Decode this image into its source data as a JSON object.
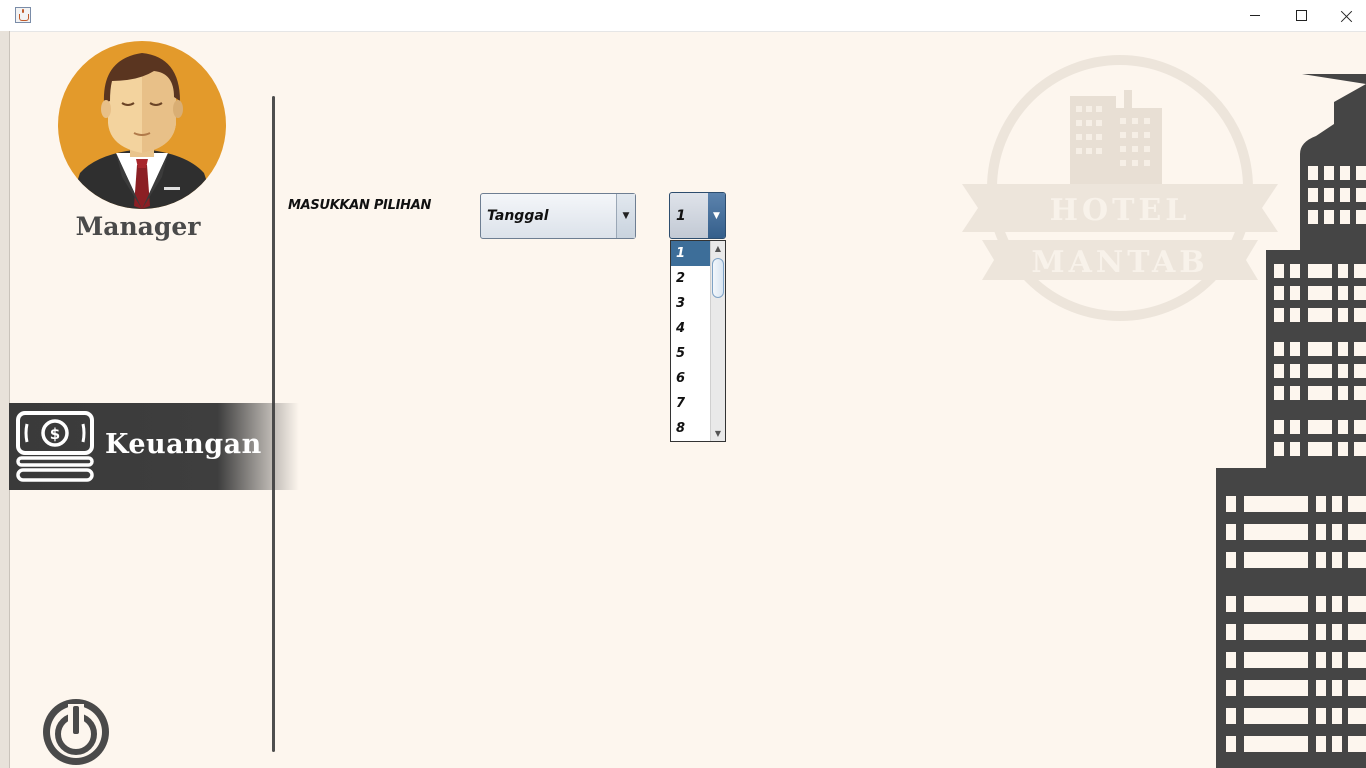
{
  "window": {
    "title": "",
    "controls": {
      "minimize": "minimize",
      "maximize": "maximize",
      "close": "close"
    }
  },
  "sidebar": {
    "role": "Manager",
    "menu": [
      {
        "label": "Keuangan",
        "icon": "money-stack-icon"
      }
    ],
    "logout_icon": "power-icon"
  },
  "form": {
    "prompt": "MASUKKAN PILIHAN",
    "filter_select": {
      "value": "Tanggal"
    },
    "day_select": {
      "value": "1",
      "open": true,
      "visible_options": [
        "1",
        "2",
        "3",
        "4",
        "5",
        "6",
        "7",
        "8"
      ],
      "highlighted": "1"
    }
  },
  "background": {
    "watermark_logo_lines": [
      "HOTEL",
      "MANTAB"
    ]
  },
  "colors": {
    "page_bg": "#fdf6ee",
    "sidebar_menu_bg": "#3e3e3e",
    "avatar_circle": "#e39a2b",
    "selected_option": "#3d6e99",
    "building": "#444444"
  }
}
